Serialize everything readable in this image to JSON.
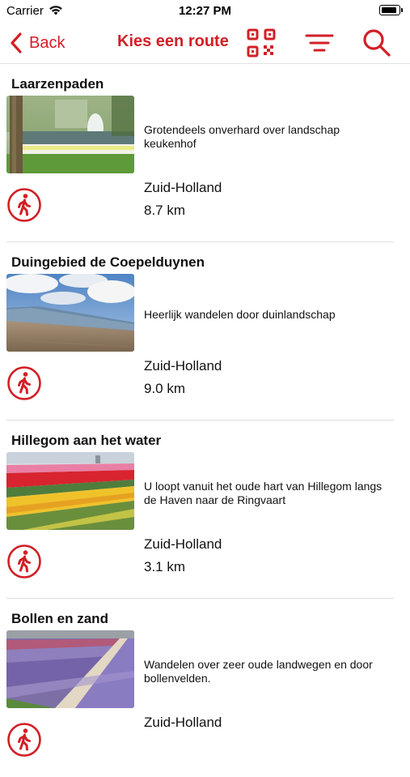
{
  "status": {
    "carrier": "Carrier",
    "time": "12:27 PM",
    "battery_level": 0.9
  },
  "nav": {
    "back_label": "Back",
    "title": "Kies een route",
    "icons": [
      "qr-code-icon",
      "filter-icon",
      "search-icon"
    ]
  },
  "colors": {
    "accent": "#d21f26"
  },
  "routes": [
    {
      "title": "Laarzenpaden",
      "description": "Grotendeels onverhard over landschap keukenhof",
      "region": "Zuid-Holland",
      "distance": "8.7 km",
      "icon": "walking-person-icon"
    },
    {
      "title": "Duingebied de Coepelduynen",
      "description": "Heerlijk wandelen door duinlandschap",
      "region": "Zuid-Holland",
      "distance": "9.0 km",
      "icon": "walking-person-icon"
    },
    {
      "title": "Hillegom aan het water",
      "description": "U loopt vanuit het oude hart van Hillegom langs de Haven naar de Ringvaart",
      "region": "Zuid-Holland",
      "distance": "3.1 km",
      "icon": "walking-person-icon"
    },
    {
      "title": "Bollen en zand",
      "description": "Wandelen over zeer oude landwegen en door bollenvelden.",
      "region": "Zuid-Holland",
      "distance": "",
      "icon": "walking-person-icon"
    }
  ]
}
